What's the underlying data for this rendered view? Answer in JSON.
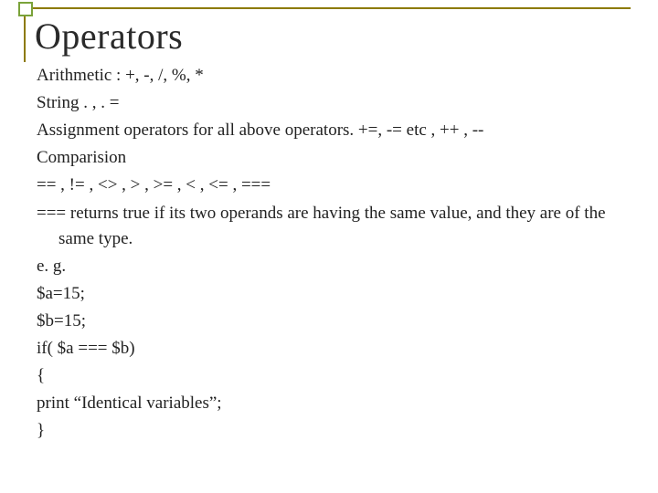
{
  "title": "Operators",
  "lines": {
    "l1": "Arithmetic : +, -, /, %, *",
    "l2": "String . , . =",
    "l3": "Assignment operators for all above operators. +=, -= etc , ++ , --",
    "l4": "Comparision",
    "l5": "== , != , <> , > , >= , < , <= , ===",
    "l6": "=== returns true if its two operands are having the same value, and they are of the same type.",
    "l7": "e. g.",
    "l8": "$a=15;",
    "l9": "$b=15;",
    "l10": "if( $a === $b)",
    "l11": "{",
    "l12": "print “Identical variables”;",
    "l13": "}"
  }
}
